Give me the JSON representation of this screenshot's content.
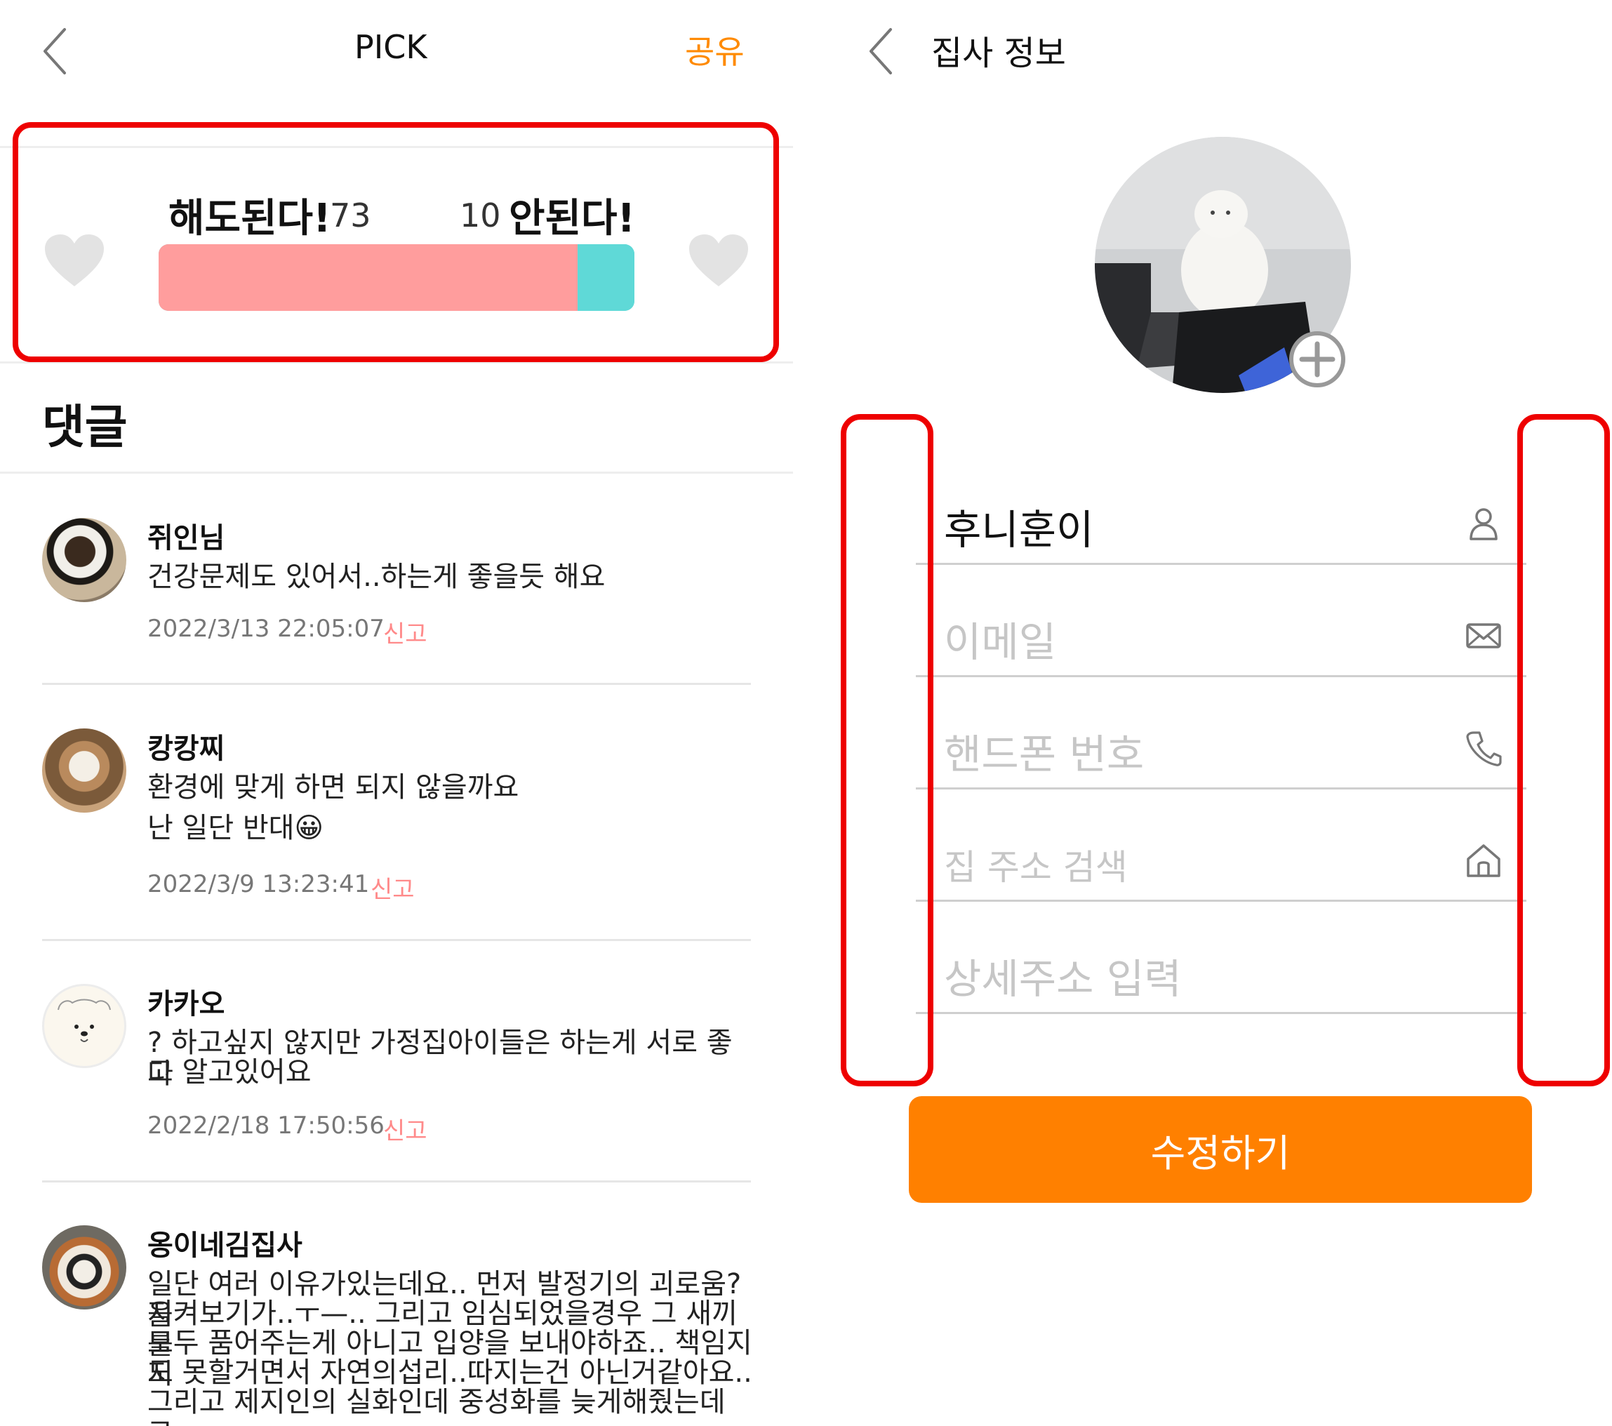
{
  "pick_screen": {
    "title": "PICK",
    "share_label": "공유",
    "vote": {
      "yes_label": "해도된다!",
      "yes_count": "73",
      "no_count": "10",
      "no_label": "안된다!",
      "yes_fraction": 0.88
    },
    "comments_title": "댓글",
    "report_label": "신고",
    "comments": [
      {
        "name": "쥐인님",
        "lines": [
          "건강문제도 있어서..하는게 좋을듯 해요"
        ],
        "time": "2022/3/13 22:05:07"
      },
      {
        "name": "캉캉찌",
        "lines": [
          "환경에 맞게 하면 되지 않을까요",
          "난 일단 반대😀"
        ],
        "time": "2022/3/9 13:23:41"
      },
      {
        "name": "카카오",
        "lines": [
          "? 하고싶지 않지만 가정집아이들은 하는게   서로 좋다",
          "고 알고있어요"
        ],
        "time": "2022/2/18 17:50:56"
      },
      {
        "name": "옹이네김집사",
        "lines": [
          "일단 여러 이유가있는데요.. 먼저 발정기의 괴로움?을",
          "지켜보기가..ㅜ—.. 그리고 임심되었을경우 그 새끼를",
          "모두 품어주는게 아니고 입양을 보내야하죠.. 책임지지",
          "도 못할거면서 자연의섭리..따지는건 아닌거같아요..",
          "그리고 제지인의 실화인데 중성화를 늦게해줬는데 그"
        ],
        "time": ""
      }
    ]
  },
  "owner_screen": {
    "title": "집사 정보",
    "fields": {
      "nickname": {
        "value": "후니훈이",
        "icon": "person-icon"
      },
      "email": {
        "placeholder": "이메일",
        "icon": "mail-icon"
      },
      "phone": {
        "placeholder": "핸드폰 번호",
        "icon": "phone-icon"
      },
      "address": {
        "placeholder": "집 주소 검색",
        "icon": "home-icon"
      },
      "address_detail": {
        "placeholder": "상세주소 입력"
      }
    },
    "submit_label": "수정하기"
  },
  "colors": {
    "accent_orange": "#ff8000",
    "share_orange": "#ff8a00",
    "yes_bar": "#ff9d9d",
    "no_bar": "#5fd9d7",
    "highlight_red": "#ee0000",
    "report_pink": "#ff8a8a"
  }
}
